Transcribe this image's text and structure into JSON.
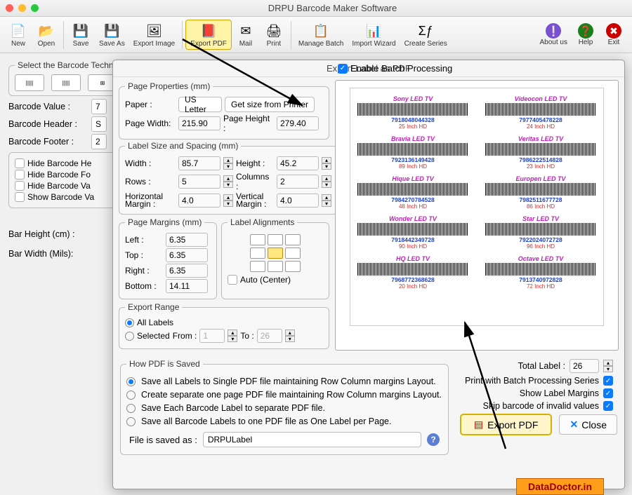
{
  "title": "DRPU Barcode Maker Software",
  "toolbar": [
    {
      "id": "new",
      "label": "New"
    },
    {
      "id": "open",
      "label": "Open"
    },
    {
      "id": "save",
      "label": "Save"
    },
    {
      "id": "saveas",
      "label": "Save As"
    },
    {
      "id": "exportimg",
      "label": "Export Image"
    },
    {
      "id": "exportpdf",
      "label": "Export PDF",
      "active": true
    },
    {
      "id": "mail",
      "label": "Mail"
    },
    {
      "id": "print",
      "label": "Print"
    },
    {
      "id": "managebatch",
      "label": "Manage Batch"
    },
    {
      "id": "importwiz",
      "label": "Import Wizard"
    },
    {
      "id": "createseries",
      "label": "Create Series"
    }
  ],
  "toolbar_right": [
    {
      "id": "about",
      "label": "About us"
    },
    {
      "id": "help",
      "label": "Help"
    },
    {
      "id": "exit",
      "label": "Exit"
    }
  ],
  "techlegend": "Select the Barcode Technologies",
  "barcode_value_lbl": "Barcode Value :",
  "barcode_value": "7",
  "barcode_header_lbl": "Barcode Header :",
  "barcode_header": "S",
  "barcode_footer_lbl": "Barcode Footer :",
  "barcode_footer": "2",
  "hide_opts": [
    "Hide Barcode He",
    "Hide Barcode Fo",
    "Hide Barcode Va",
    "Show Barcode Va"
  ],
  "bar_height_lbl": "Bar Height (cm) :",
  "bar_width_lbl": "Bar Width (Mils):",
  "modal": {
    "enable_batch": "Enable Batch Processing",
    "title": "Export Label as PDF",
    "page_props": "Page Properties (mm)",
    "paper_lbl": "Paper :",
    "paper": "US Letter",
    "getsize": "Get size from Printer",
    "pwidth_lbl": "Page Width:",
    "pwidth": "215.90",
    "pheight_lbl": "Page Height :",
    "pheight": "279.40",
    "labelsize": "Label Size and Spacing (mm)",
    "width_lbl": "Width :",
    "width": "85.7",
    "height_lbl": "Height :",
    "height": "45.2",
    "rows_lbl": "Rows :",
    "rows": "5",
    "cols_lbl": "Columns :",
    "cols": "2",
    "hmargin_lbl": "Horizontal Margin :",
    "hmargin": "4.0",
    "vmargin_lbl": "Vertical Margin :",
    "vmargin": "4.0",
    "margins": "Page Margins (mm)",
    "left_lbl": "Left :",
    "left": "6.35",
    "top_lbl": "Top :",
    "top": "6.35",
    "right_lbl": "Right :",
    "right": "6.35",
    "bottom_lbl": "Bottom :",
    "bottom": "14.11",
    "alignments": "Label Alignments",
    "auto_center": "Auto (Center)",
    "export_range": "Export Range",
    "all_labels": "All Labels",
    "selected": "Selected",
    "from_lbl": "From :",
    "from": "1",
    "to_lbl": "To :",
    "to": "26",
    "how_saved": "How PDF is Saved",
    "save_opts": [
      "Save all Labels to Single PDF file maintaining Row Column margins Layout.",
      "Create separate one page PDF file maintaining Row Column margins Layout.",
      "Save Each Barcode Label to separate PDF file.",
      "Save all Barcode Labels to one PDF file as One Label per Page."
    ],
    "file_saved_lbl": "File is saved as :",
    "file_saved": "DRPULabel",
    "total_label_lbl": "Total Label :",
    "total_label": "26",
    "print_batch": "Print with Batch Processing Series",
    "show_margins": "Show Label Margins",
    "skip_invalid": "Skip barcode of invalid values",
    "export_btn": "Export PDF",
    "close_btn": "Close",
    "barcodes": [
      [
        {
          "h": "Sony LED TV",
          "n": "7918048044328",
          "f": "25 Inch HD"
        },
        {
          "h": "Videocon LED TV",
          "n": "7977405478228",
          "f": "24 Inch HD"
        }
      ],
      [
        {
          "h": "Bravia LED TV",
          "n": "7923136149428",
          "f": "89 Inch HD"
        },
        {
          "h": "Veritas LED TV",
          "n": "7986222514828",
          "f": "23 Inch HD"
        }
      ],
      [
        {
          "h": "Hique LED TV",
          "n": "7984270784528",
          "f": "48 Inch HD"
        },
        {
          "h": "Europen LED TV",
          "n": "7982511677728",
          "f": "86 Inch HD"
        }
      ],
      [
        {
          "h": "Wonder LED TV",
          "n": "7918442349728",
          "f": "90 Inch HD"
        },
        {
          "h": "Star LED TV",
          "n": "7922024072728",
          "f": "96 Inch HD"
        }
      ],
      [
        {
          "h": "HQ LED TV",
          "n": "7968772368628",
          "f": "20 Inch HD"
        },
        {
          "h": "Octave LED TV",
          "n": "7913740972828",
          "f": "72 Inch HD"
        }
      ]
    ]
  },
  "watermark": "DataDoctor.in"
}
